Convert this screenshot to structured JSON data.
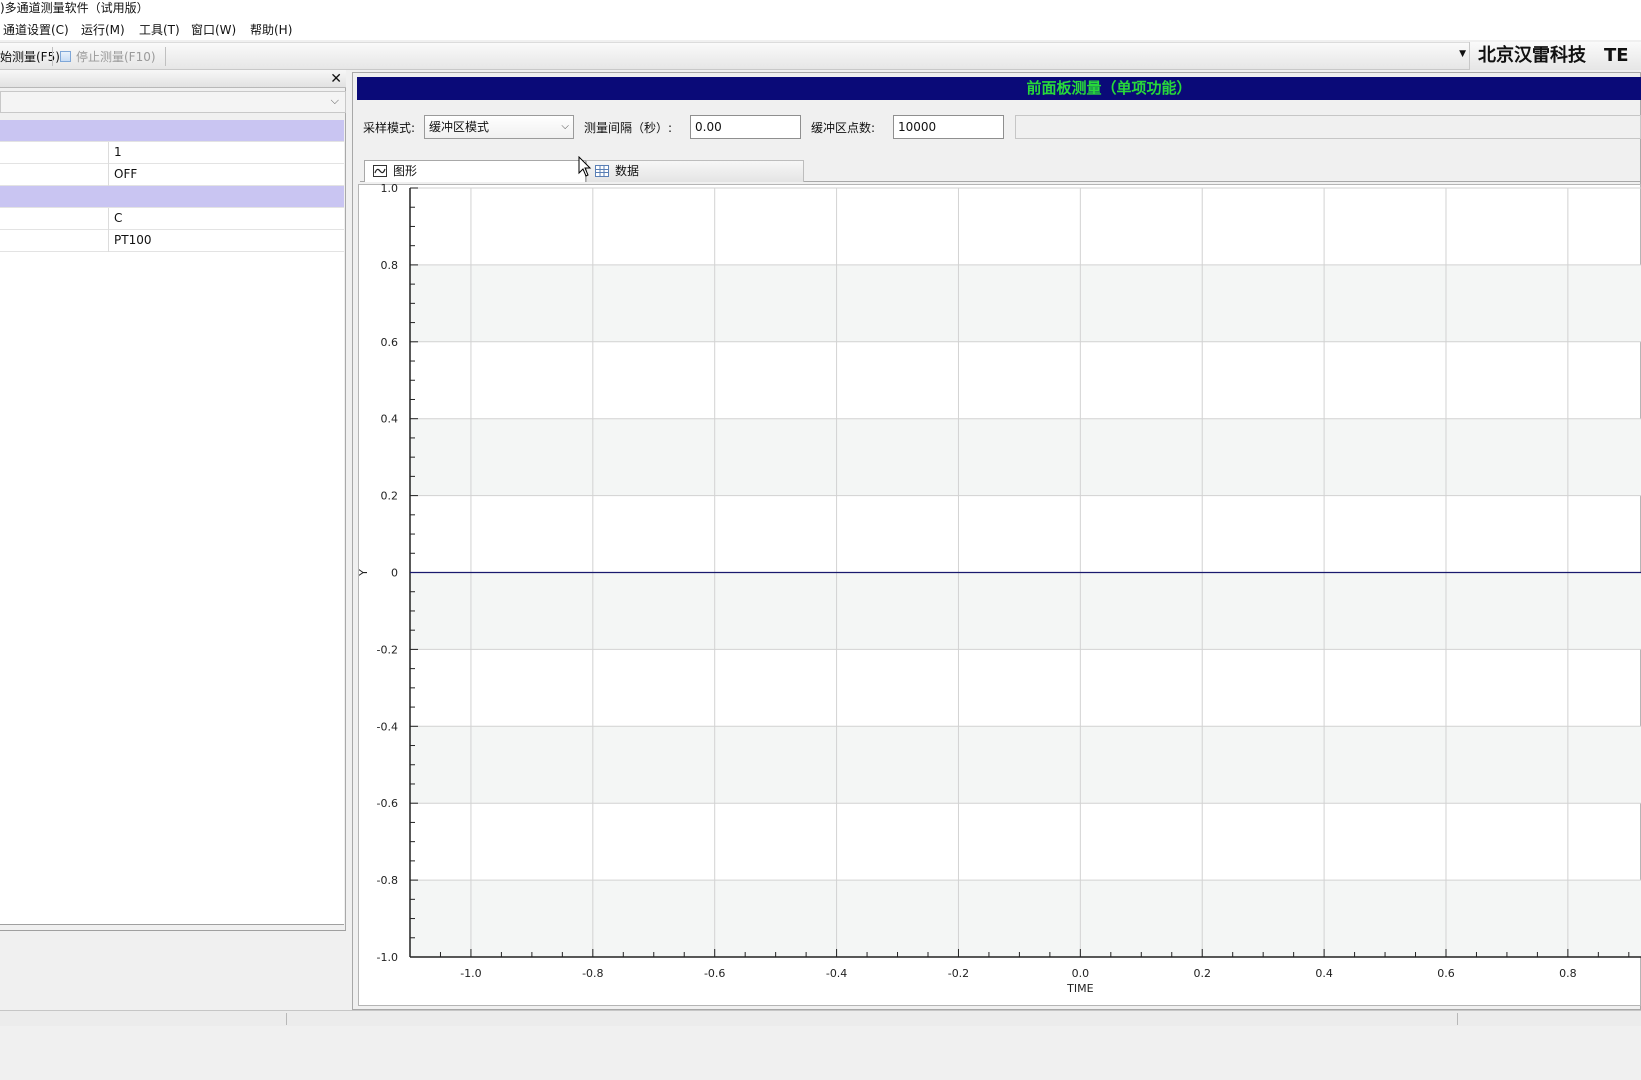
{
  "window": {
    "title": ")多通道测量软件（试用版）"
  },
  "menu": {
    "items": [
      "通道设置(C)",
      "运行(M)",
      "工具(T)",
      "窗口(W)",
      "帮助(H)"
    ]
  },
  "toolbar": {
    "start_label": "始测量(F5)",
    "stop_label": "停止测量(F10)",
    "company": "北京汉雷科技　TE"
  },
  "left_panel": {
    "close_glyph": "✕",
    "combo_value": "",
    "rows": [
      {
        "kind": "category",
        "label": "",
        "value": ""
      },
      {
        "kind": "property",
        "label": "",
        "value": "1"
      },
      {
        "kind": "property",
        "label": "",
        "value": "OFF"
      },
      {
        "kind": "category",
        "label": "",
        "value": ""
      },
      {
        "kind": "property",
        "label": "",
        "value": "C"
      },
      {
        "kind": "property",
        "label": "",
        "value": "PT100"
      }
    ]
  },
  "panel": {
    "banner": "前面板测量（单项功能）",
    "sampling_mode_label": "采样模式:",
    "sampling_mode_value": "缓冲区模式",
    "interval_label": "测量间隔（秒）:",
    "interval_value": "0.00",
    "buffer_label": "缓冲区点数:",
    "buffer_value": "10000",
    "tabs": [
      "图形",
      "数据"
    ],
    "active_tab": "图形"
  },
  "chart_data": {
    "type": "line",
    "title": "",
    "xlabel": "TIME",
    "ylabel": "Y",
    "xlim": [
      -1.1,
      0.92
    ],
    "ylim": [
      -1.0,
      1.0
    ],
    "x_ticks": [
      -1.0,
      -0.8,
      -0.6,
      -0.4,
      -0.2,
      0.0,
      0.2,
      0.4,
      0.6,
      0.8
    ],
    "x_tick_labels": [
      "-1.0",
      "-0.8",
      "-0.6",
      "-0.4",
      "-0.2",
      "0.0",
      "0.2",
      "0.4",
      "0.6",
      "0.8"
    ],
    "y_ticks": [
      1.0,
      0.8,
      0.6,
      0.4,
      0.2,
      0.0,
      -0.2,
      -0.4,
      -0.6,
      -0.8,
      -1.0
    ],
    "y_tick_labels": [
      "1.0",
      "0.8",
      "0.6",
      "0.4",
      "0.2",
      "0",
      "-0.2",
      "-0.4",
      "-0.6",
      "-0.8",
      "-1.0"
    ],
    "grid": true,
    "series": [
      {
        "x": [
          -1.1,
          0.92
        ],
        "y": [
          0,
          0
        ],
        "color": "#1a1a6e"
      }
    ]
  },
  "colors": {
    "banner_bg": "#0a0a78",
    "banner_text": "#28d93a",
    "category_row": "#c9c5f2",
    "plot_band": "#f4f6f5",
    "grid": "#d2d2d2"
  }
}
